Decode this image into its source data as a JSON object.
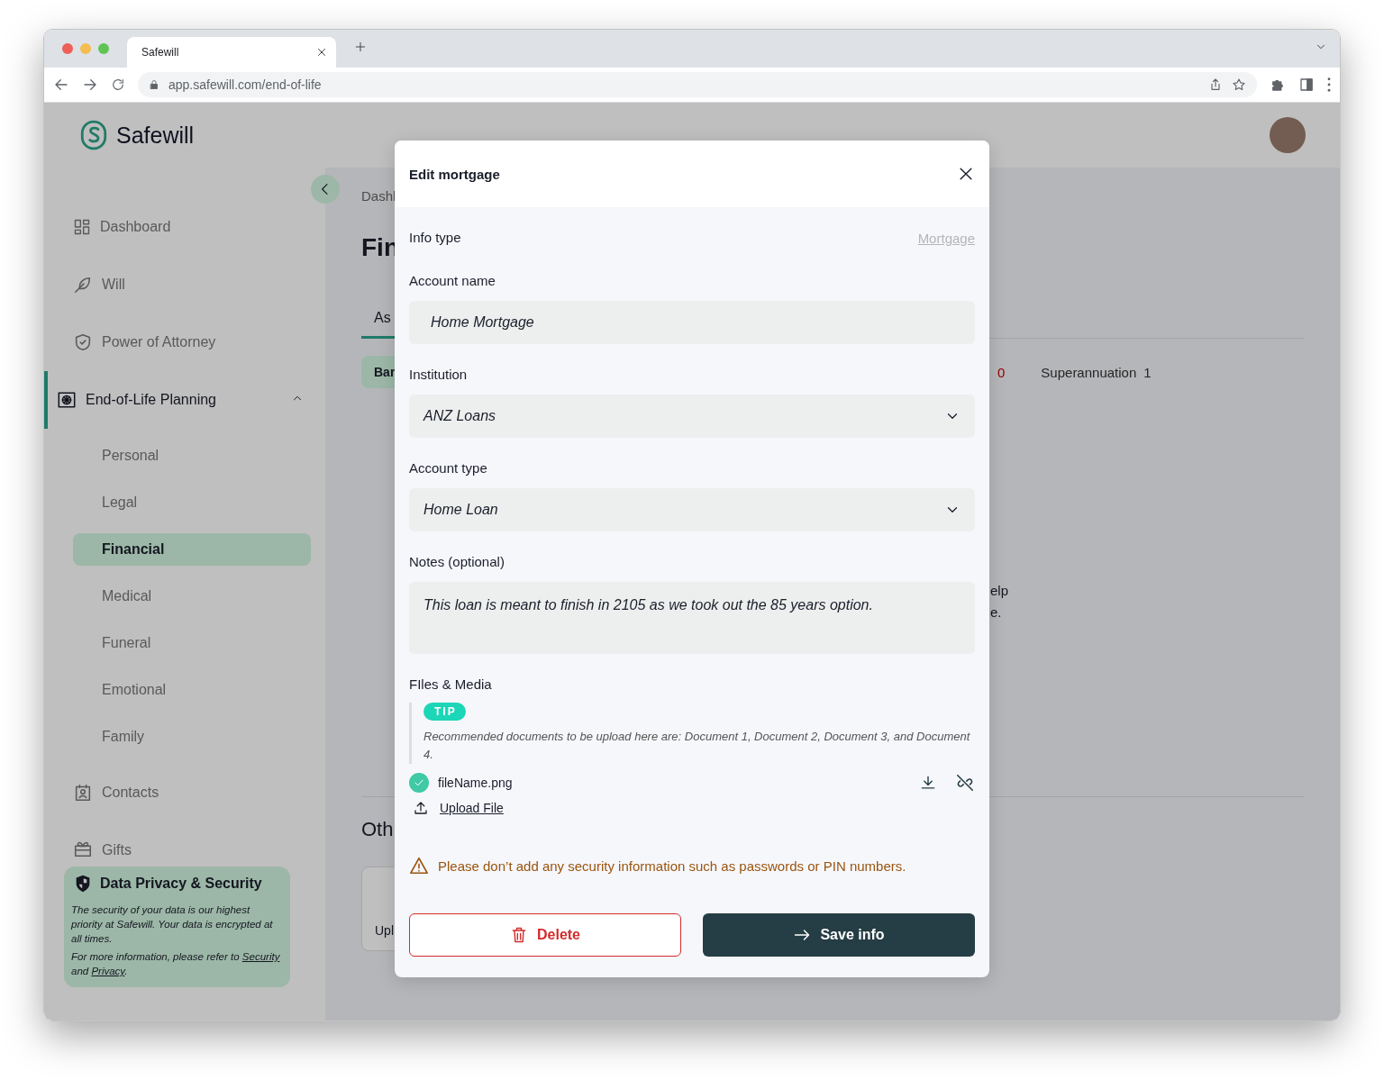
{
  "browser": {
    "tab_title": "Safewill",
    "url": "app.safewill.com/end-of-life"
  },
  "header": {
    "logo_text": "Safewill"
  },
  "sidebar": {
    "items": [
      {
        "label": "Dashboard",
        "selected": false
      },
      {
        "label": "Will",
        "selected": false
      },
      {
        "label": "Power of Attorney",
        "selected": false
      },
      {
        "label": "End-of-Life Planning",
        "selected": true,
        "expanded": true,
        "children": [
          {
            "label": "Personal",
            "selected": false
          },
          {
            "label": "Legal",
            "selected": false
          },
          {
            "label": "Financial",
            "selected": true
          },
          {
            "label": "Medical",
            "selected": false
          },
          {
            "label": "Funeral",
            "selected": false
          },
          {
            "label": "Emotional",
            "selected": false
          },
          {
            "label": "Family",
            "selected": false
          }
        ]
      },
      {
        "label": "Contacts",
        "selected": false
      },
      {
        "label": "Gifts",
        "selected": false
      }
    ],
    "privacy_card": {
      "title": "Data Privacy & Security",
      "body": "The security of your data is our highest priority at Safewill. Your data is encrypted at all times.",
      "note": "For more information, please refer to",
      "links": [
        "Security",
        "Privacy"
      ],
      "joiner": "and",
      "end": "."
    }
  },
  "main": {
    "breadcrumb": "Dashl",
    "title": "Fin",
    "tabs": [
      {
        "label": "As",
        "selected": true
      }
    ],
    "chip": "Bar",
    "count": "0",
    "category": "Superannuation",
    "category_count": "1",
    "help_lines": [
      "elp",
      "e."
    ],
    "section_title": "Oth",
    "card_label": "Upl"
  },
  "modal": {
    "title": "Edit mortgage",
    "info_type": {
      "label": "Info type",
      "value": "Mortgage"
    },
    "fields": [
      {
        "kind": "text",
        "label": "Account name",
        "value": "Home Mortgage"
      },
      {
        "kind": "select",
        "label": "Institution",
        "value": "ANZ Loans"
      },
      {
        "kind": "select",
        "label": "Account type",
        "value": "Home Loan"
      },
      {
        "kind": "textarea",
        "label": "Notes (optional)",
        "value": "This loan is meant to finish in 2105 as we took out the 85 years option."
      }
    ],
    "files": {
      "label": "FIles & Media",
      "tip_badge": "TIP",
      "tip": "Recommended documents to be upload here are: Document 1, Document 2, Document 3, and Document 4.",
      "items": [
        {
          "name": "fileName.png",
          "uploaded": true
        }
      ],
      "upload": "Upload File"
    },
    "warning": "Please don’t add any security information such as passwords or PIN numbers.",
    "buttons": {
      "delete": "Delete",
      "save": "Save info"
    }
  }
}
